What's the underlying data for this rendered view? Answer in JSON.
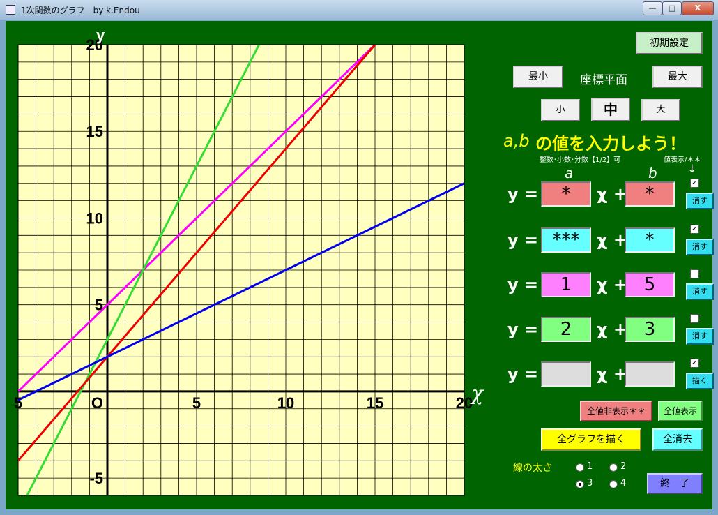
{
  "window": {
    "title": "1次関数のグラフ　by k.Endou",
    "min": "—",
    "max": "□",
    "close": "X"
  },
  "buttons": {
    "reset": "初期設定",
    "min": "最小",
    "max": "最大",
    "small": "小",
    "medium": "中",
    "large": "大",
    "hide_all": "全値非表示＊＊",
    "show_all": "全値表示",
    "draw_all": "全グラフを描く",
    "clear_all": "全消去",
    "exit": "終　了"
  },
  "labels": {
    "plane": "座標平面",
    "heading_ab": "a,b",
    "heading_rest": "の値を入力しよう！",
    "note": "整数･小数･分数【1/2】可",
    "value_display": "値表示/＊＊",
    "arrow": "↓",
    "col_a": "a",
    "col_b": "b",
    "yeq": "y =",
    "xplus": "χ +",
    "thickness": "線の太さ"
  },
  "rows": [
    {
      "a": "*",
      "b": "*",
      "checked": true,
      "button": "消す",
      "color": "#f08080"
    },
    {
      "a": "***",
      "b": "*",
      "checked": true,
      "button": "消す",
      "color": "#66ffff"
    },
    {
      "a": "1",
      "b": "5",
      "checked": false,
      "button": "消す",
      "color": "#ff80ff"
    },
    {
      "a": "2",
      "b": "3",
      "checked": false,
      "button": "消す",
      "color": "#80ff80"
    },
    {
      "a": "",
      "b": "",
      "checked": true,
      "button": "描く",
      "color": "#dddddd"
    }
  ],
  "thickness_options": [
    "1",
    "2",
    "3",
    "4"
  ],
  "thickness_selected": "3",
  "chart_data": {
    "type": "line",
    "xlabel": "χ",
    "ylabel": "y",
    "origin_label": "O",
    "xlim": [
      -5,
      20
    ],
    "ylim": [
      -6,
      20
    ],
    "xticks": [
      -5,
      5,
      10,
      15,
      20
    ],
    "yticks": [
      -5,
      5,
      10,
      15,
      20
    ],
    "xtick_labels": [
      "5",
      "5",
      "10",
      "15",
      "20"
    ],
    "ytick_labels": [
      "-5",
      "5",
      "10",
      "15",
      "20"
    ],
    "grid": true,
    "series": [
      {
        "color": "#ff00ff",
        "slope": 1,
        "intercept": 5
      },
      {
        "color": "#33dd33",
        "slope": 2,
        "intercept": 3
      },
      {
        "color": "#ee0000",
        "slope": 1.2,
        "intercept": 2
      },
      {
        "color": "#0000ee",
        "slope": 0.5,
        "intercept": 2
      }
    ]
  }
}
